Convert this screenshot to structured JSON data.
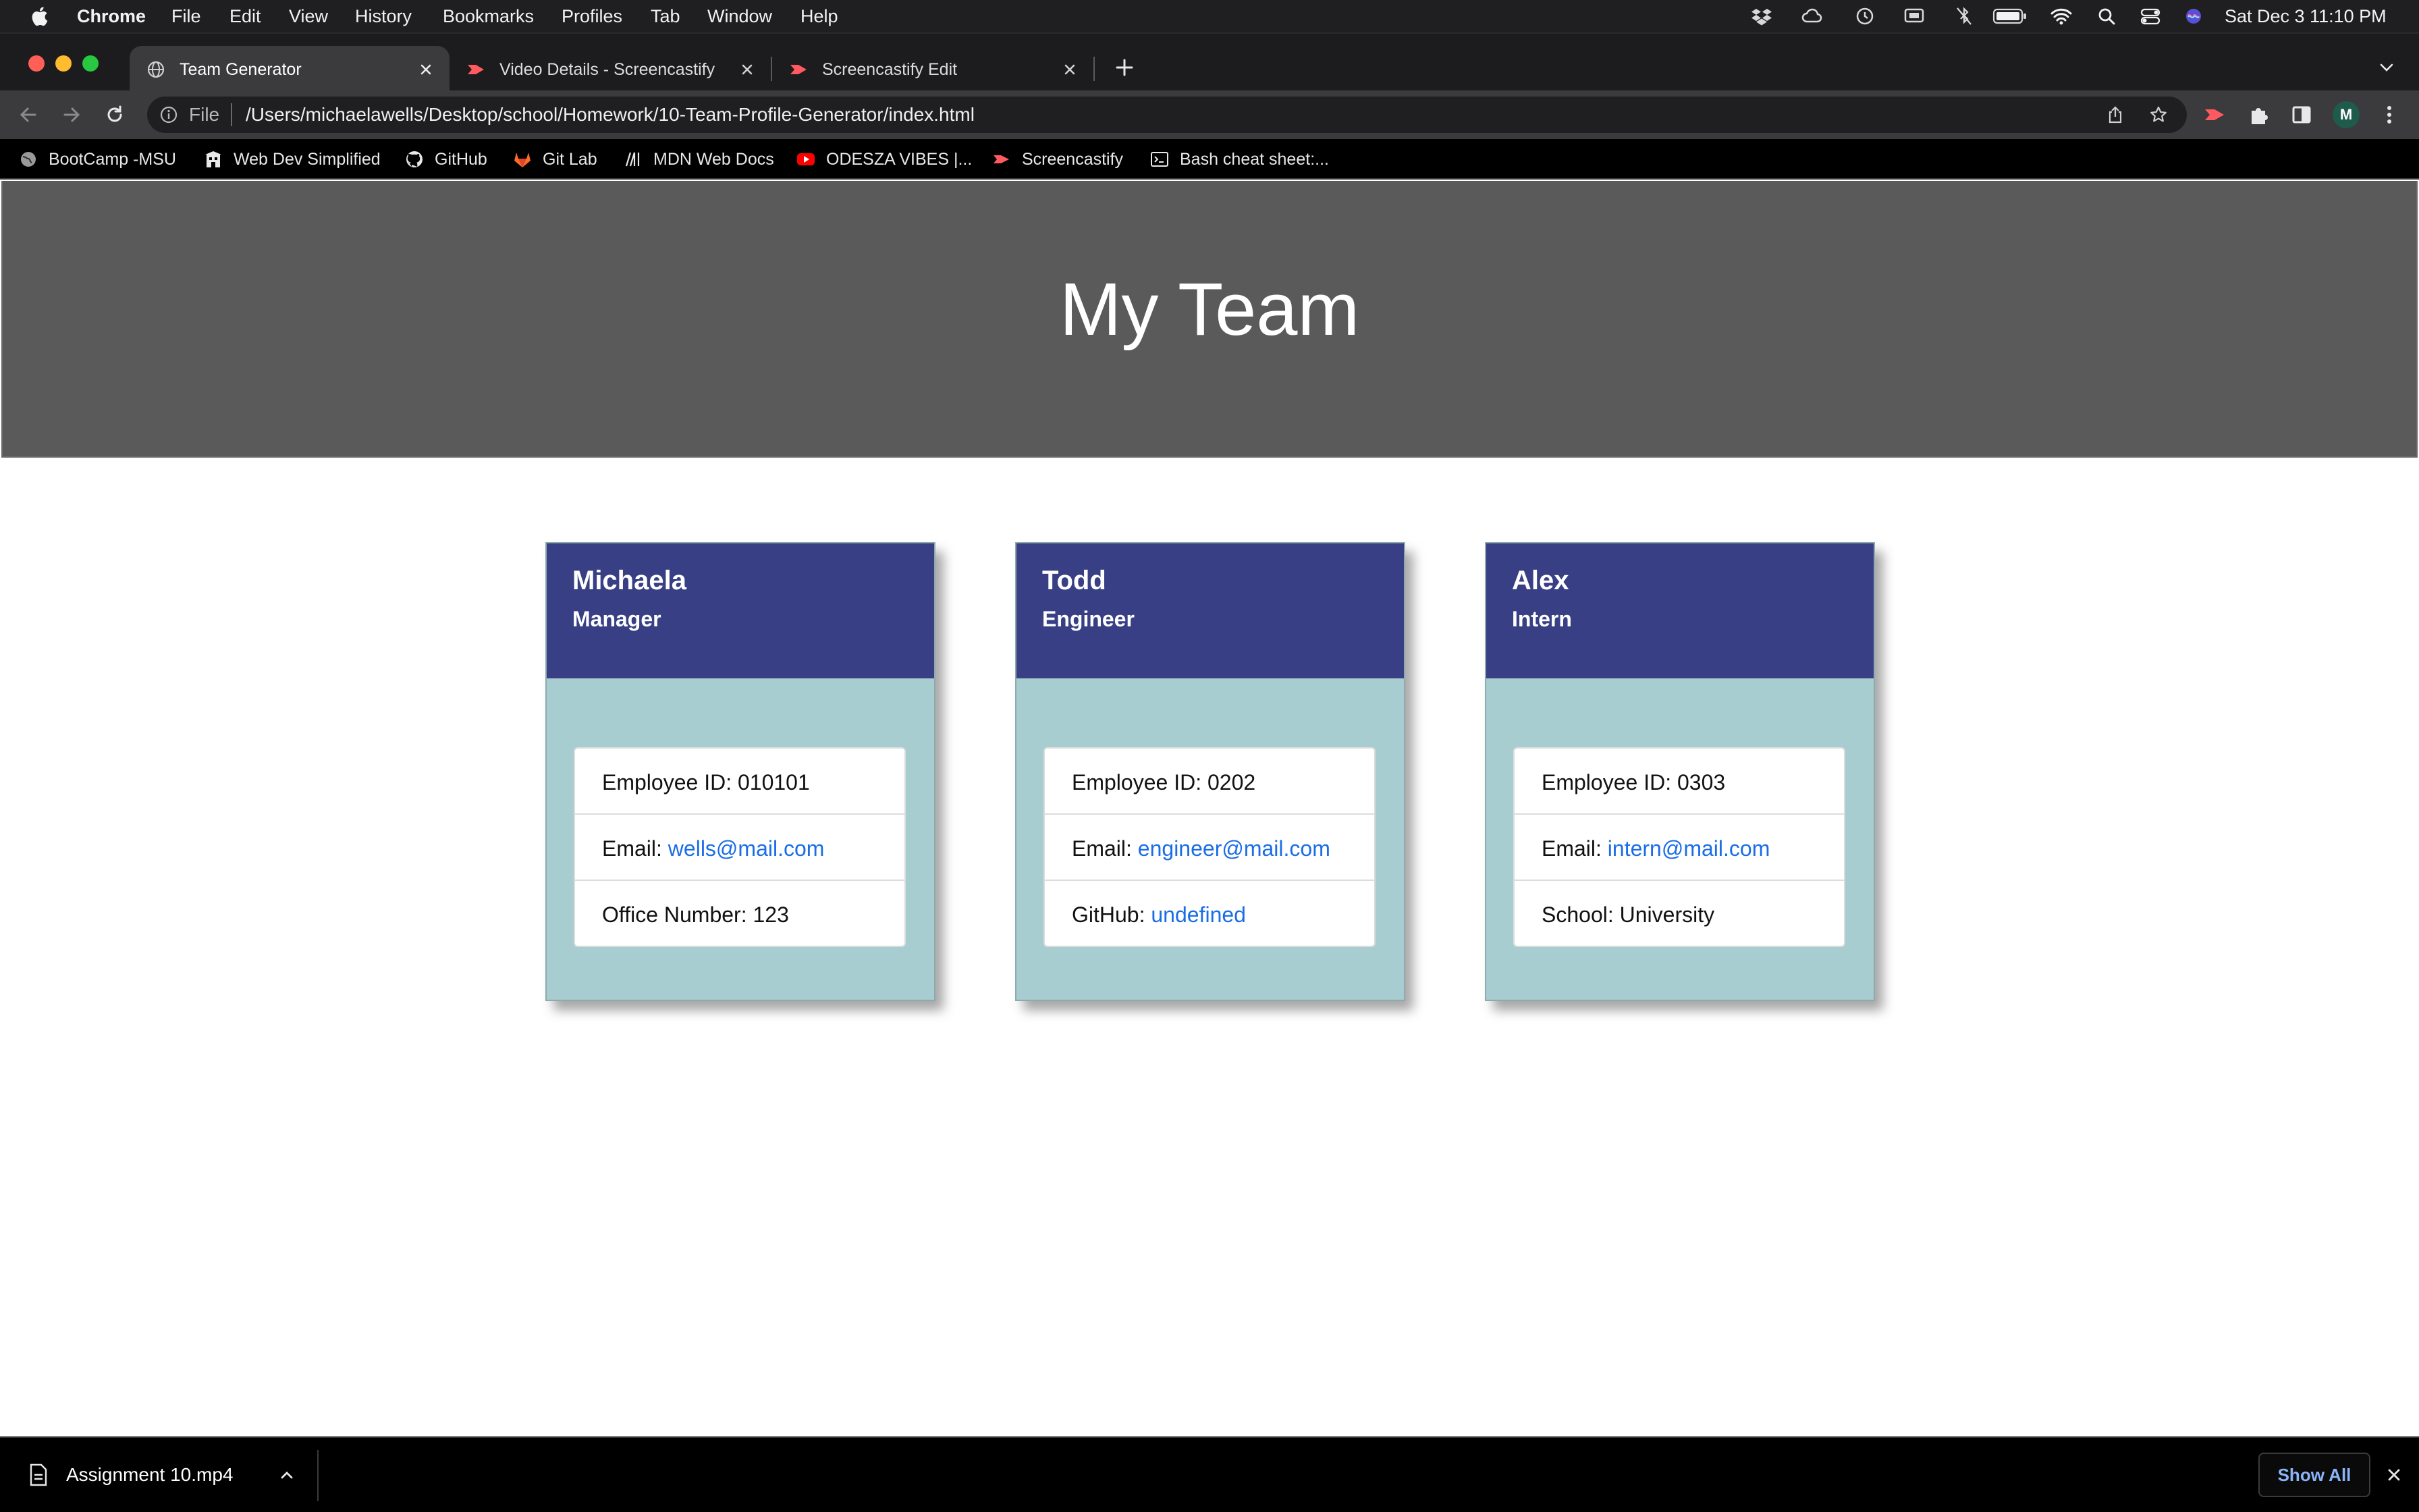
{
  "menubar": {
    "app_name": "Chrome",
    "menus": [
      "File",
      "Edit",
      "View",
      "History",
      "Bookmarks",
      "Profiles",
      "Tab",
      "Window",
      "Help"
    ],
    "clock": "Sat Dec 3  11:10 PM",
    "tray_icons": [
      "dropbox-icon",
      "creative-cloud-icon",
      "time-machine-icon",
      "screen-share-icon",
      "bluetooth-off-icon",
      "battery-icon",
      "wifi-icon",
      "search-icon",
      "control-center-icon",
      "siri-icon"
    ]
  },
  "tabs": [
    {
      "title": "Team Generator",
      "active": true,
      "icon": "globe-icon"
    },
    {
      "title": "Video Details - Screencastify",
      "active": false,
      "icon": "screencastify-icon"
    },
    {
      "title": "Screencastify Edit",
      "active": false,
      "icon": "screencastify-icon"
    }
  ],
  "toolbar": {
    "scheme": "File",
    "url": "/Users/michaelawells/Desktop/school/Homework/10-Team-Profile-Generator/index.html",
    "avatar_initial": "M"
  },
  "bookmarks": [
    {
      "label": "BootCamp -MSU",
      "icon": "globe-icon"
    },
    {
      "label": "Web Dev Simplified",
      "icon": "building-icon"
    },
    {
      "label": "GitHub",
      "icon": "github-icon"
    },
    {
      "label": "Git Lab",
      "icon": "gitlab-icon"
    },
    {
      "label": "MDN Web Docs",
      "icon": "mdn-icon"
    },
    {
      "label": "ODESZA VIBES |...",
      "icon": "youtube-icon"
    },
    {
      "label": "Screencastify",
      "icon": "screencastify-icon"
    },
    {
      "label": "Bash cheat sheet:...",
      "icon": "terminal-icon"
    }
  ],
  "page": {
    "title": "My Team",
    "cards": [
      {
        "name": "Michaela",
        "role": "Manager",
        "id_label": "Employee ID: ",
        "id_value": "010101",
        "email_label": "Email: ",
        "email": "wells@mail.com",
        "extra_label": "Office Number: ",
        "extra_value": "123",
        "extra_is_link": false
      },
      {
        "name": "Todd",
        "role": "Engineer",
        "id_label": "Employee ID: ",
        "id_value": "0202",
        "email_label": "Email: ",
        "email": "engineer@mail.com",
        "extra_label": "GitHub: ",
        "extra_value": "undefined",
        "extra_is_link": true
      },
      {
        "name": "Alex",
        "role": "Intern",
        "id_label": "Employee ID: ",
        "id_value": "0303",
        "email_label": "Email: ",
        "email": "intern@mail.com",
        "extra_label": "School: ",
        "extra_value": "University",
        "extra_is_link": false
      }
    ]
  },
  "downloads": {
    "file_name": "Assignment 10.mp4",
    "show_all_label": "Show All"
  },
  "colors": {
    "card_header": "#383f84",
    "card_body": "#a8cdd0",
    "jumbotron": "#5a5a5a",
    "link": "#1a6de6"
  }
}
